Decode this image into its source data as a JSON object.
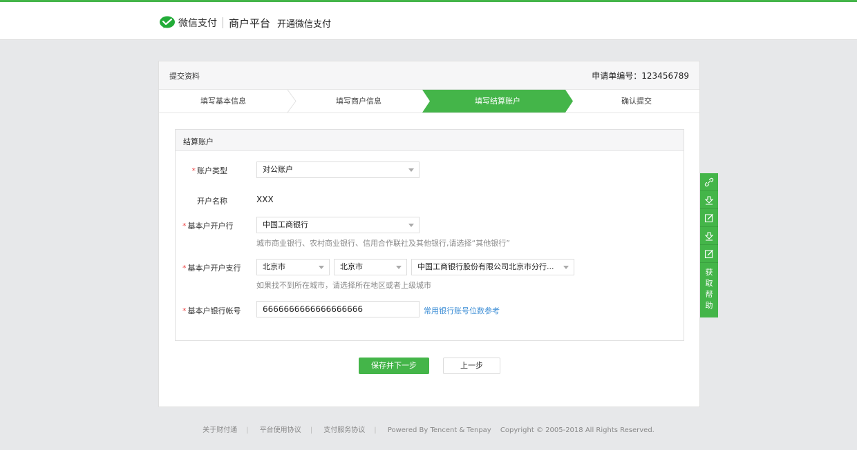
{
  "header": {
    "brand": "微信支付",
    "platform": "商户平台",
    "page": "开通微信支付"
  },
  "card": {
    "title": "提交资料",
    "apply_no": "申请单编号：123456789"
  },
  "steps": [
    {
      "label": "填写基本信息"
    },
    {
      "label": "填写商户信息"
    },
    {
      "label": "填写结算账户",
      "active": true
    },
    {
      "label": "确认提交"
    }
  ],
  "section": {
    "title": "结算账户",
    "account_type": {
      "label": "账户类型",
      "value": "对公账户"
    },
    "account_name": {
      "label": "开户名称",
      "value": "XXX"
    },
    "bank": {
      "label": "基本户开户行",
      "value": "中国工商银行",
      "hint": "城市商业银行、农村商业银行、信用合作联社及其他银行,请选择“其他银行”"
    },
    "branch": {
      "label": "基本户开户支行",
      "province": "北京市",
      "city": "北京市",
      "branch": "中国工商银行股份有限公司北京市分行...",
      "hint": "如果找不到所在城市，请选择所在地区或者上级城市"
    },
    "account_no": {
      "label": "基本户银行帐号",
      "value": "6666666666666666666",
      "link": "常用银行账号位数参考"
    }
  },
  "buttons": {
    "save_next": "保存并下一步",
    "prev": "上一步"
  },
  "sidebar": {
    "help": "获取帮助",
    "icons": [
      "link-icon",
      "download-icon",
      "edit-icon",
      "download-icon",
      "edit-icon"
    ]
  },
  "footer": {
    "about": "关于财付通",
    "terms": "平台使用协议",
    "service": "支付服务协议",
    "powered": "Powered By Tencent & Tenpay",
    "copyright": "Copyright © 2005-2018 All Rights Reserved."
  },
  "colors": {
    "accent": "#44b549",
    "link": "#3f8fd6",
    "required": "#e44444"
  }
}
